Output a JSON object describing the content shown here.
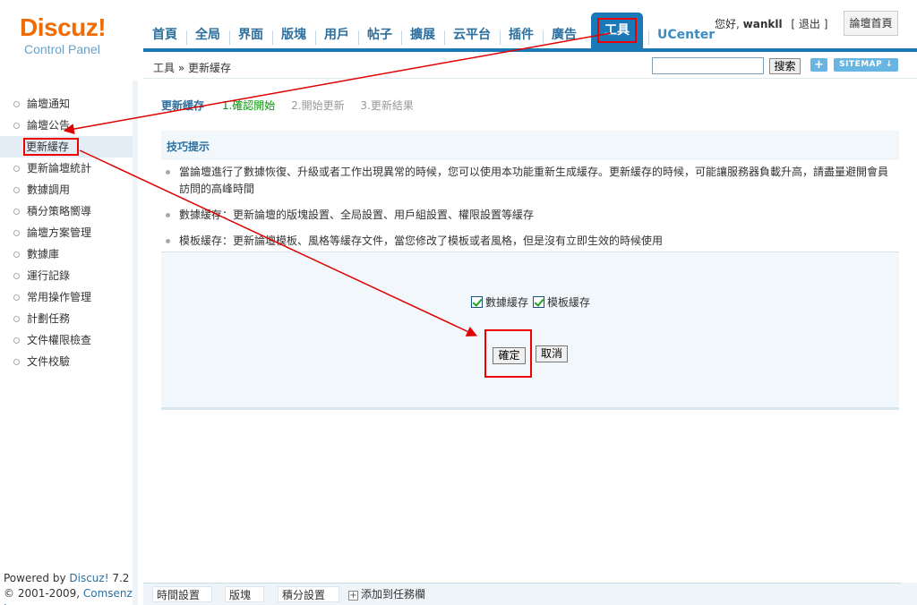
{
  "logo": {
    "brand": "Discuz!",
    "subtitle": "Control Panel"
  },
  "nav": {
    "items": [
      "首頁",
      "全局",
      "界面",
      "版塊",
      "用戶",
      "帖子",
      "擴展",
      "云平台",
      "插件",
      "廣告"
    ],
    "active": "工具",
    "ucenter": "UCenter"
  },
  "user": {
    "greeting": "您好,",
    "name": "wankll",
    "logout": "[ 退出 ]",
    "home_button": "論壇首頁"
  },
  "breadcrumb": "工具 » 更新緩存",
  "search": {
    "value": "",
    "button": "搜索",
    "plus": "+",
    "sitemap": "SITEMAP ↓"
  },
  "sidebar": {
    "items": [
      "論壇通知",
      "論壇公告",
      "更新緩存",
      "更新論壇統計",
      "數據調用",
      "積分策略嚮導",
      "論壇方案管理",
      "數據庫",
      "運行記錄",
      "常用操作管理",
      "計劃任務",
      "文件權限檢查",
      "文件校驗"
    ],
    "active_index": 2
  },
  "footer": {
    "powered_prefix": "Powered by ",
    "powered_link": "Discuz!",
    "version": " 7.2",
    "copyright_prefix": "© 2001-2009, ",
    "company": "Comsenz Inc."
  },
  "steps": {
    "current": "更新緩存",
    "step1": "1.確認開始",
    "step2": "2.開始更新",
    "step3": "3.更新結果"
  },
  "tips": {
    "title": "技巧提示",
    "items": [
      "當論壇進行了數據恢復、升級或者工作出現異常的時候，您可以使用本功能重新生成緩存。更新緩存的時候，可能讓服務器負載升高，請盡量避開會員訪問的高峰時間",
      "數據緩存：更新論壇的版塊設置、全局設置、用戶組設置、權限設置等緩存",
      "模板緩存：更新論壇模板、風格等緩存文件，當您修改了模板或者風格，但是沒有立即生效的時候使用"
    ]
  },
  "form": {
    "options": [
      {
        "label": "數據緩存",
        "checked": true
      },
      {
        "label": "模板緩存",
        "checked": true
      }
    ],
    "confirm": "確定",
    "cancel": "取消"
  },
  "taskbar": {
    "tasks": [
      "時間設置",
      "版塊",
      "積分設置"
    ],
    "close": "x",
    "add": "添加到任務欄"
  },
  "colors": {
    "accent": "#1c79b8",
    "brand": "#f26b00",
    "annotation": "#e00000"
  }
}
